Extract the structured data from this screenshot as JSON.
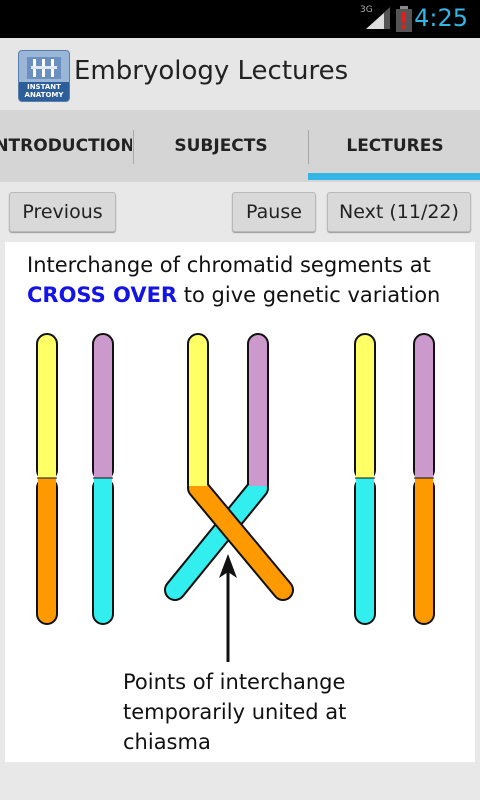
{
  "status_bar": {
    "time": "4:25",
    "network": "3G",
    "network_icon": "signal-icon",
    "battery_icon": "battery-alert-icon",
    "accent": "#33b5e5"
  },
  "action_bar": {
    "title": "Embryology Lectures",
    "icon_text_1": "INSTANT",
    "icon_text_2": "ANATOMY"
  },
  "tabs": [
    {
      "label": "INTRODUCTION",
      "selected": false
    },
    {
      "label": "SUBJECTS",
      "selected": false
    },
    {
      "label": "LECTURES",
      "selected": true
    }
  ],
  "controls": {
    "previous_label": "Previous",
    "pause_label": "Pause",
    "next_label": "Next (11/22)"
  },
  "slide": {
    "caption_line1": "Interchange of chromatid segments at",
    "caption_highlight": "CROSS OVER",
    "caption_rest": " to give genetic variation",
    "note_line1": "Points of interchange",
    "note_line2": "temporarily united at",
    "note_line3": "chiasma",
    "colors": {
      "yellow": "#ffff66",
      "orange": "#ff9900",
      "purple": "#cc99cc",
      "cyan": "#33eeee",
      "highlight": "#1414e6"
    }
  }
}
